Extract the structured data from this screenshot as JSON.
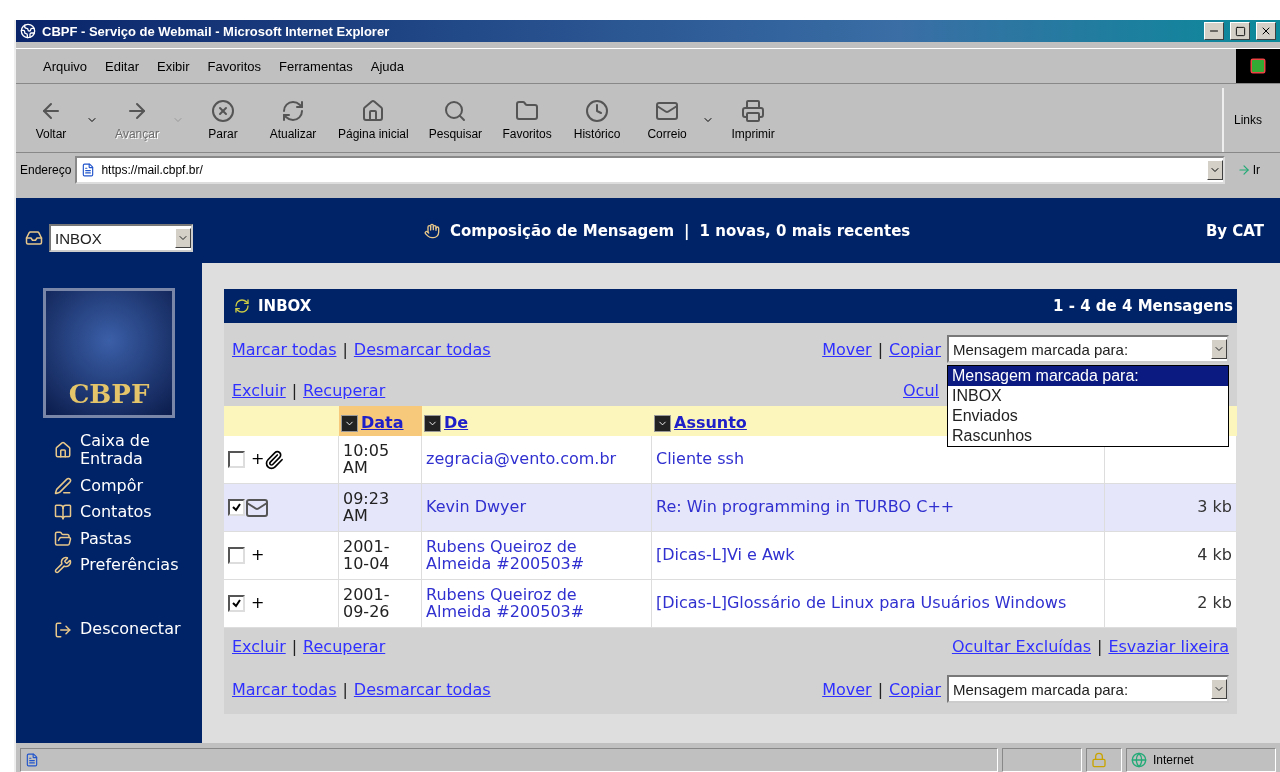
{
  "window": {
    "title": "CBPF - Serviço de Webmail - Microsoft Internet Explorer"
  },
  "menu": [
    "Arquivo",
    "Editar",
    "Exibir",
    "Favoritos",
    "Ferramentas",
    "Ajuda"
  ],
  "toolbar": [
    {
      "kind": "back",
      "label": "Voltar",
      "disabled": false,
      "dropdown": true
    },
    {
      "kind": "forward",
      "label": "Avançar",
      "disabled": true,
      "dropdown": true
    },
    {
      "kind": "stop",
      "label": "Parar",
      "disabled": false,
      "dropdown": false
    },
    {
      "kind": "refresh",
      "label": "Atualizar",
      "disabled": false,
      "dropdown": false
    },
    {
      "kind": "home",
      "label": "Página inicial",
      "disabled": false,
      "dropdown": false
    },
    {
      "kind": "search",
      "label": "Pesquisar",
      "disabled": false,
      "dropdown": false
    },
    {
      "kind": "favorites",
      "label": "Favoritos",
      "disabled": false,
      "dropdown": false
    },
    {
      "kind": "history",
      "label": "Histórico",
      "disabled": false,
      "dropdown": false
    },
    {
      "kind": "mail",
      "label": "Correio",
      "disabled": false,
      "dropdown": true
    },
    {
      "kind": "print",
      "label": "Imprimir",
      "disabled": false,
      "dropdown": false
    }
  ],
  "links_label": "Links",
  "address": {
    "label": "Endereço",
    "value": "https://mail.cbpf.br/",
    "go": "Ir"
  },
  "sidebar": {
    "folder": "INBOX",
    "logo_text": "CBPF",
    "items": [
      {
        "kind": "home",
        "label": "Caixa de Entrada"
      },
      {
        "kind": "compose",
        "label": "Compôr"
      },
      {
        "kind": "contacts",
        "label": "Contatos"
      },
      {
        "kind": "folders",
        "label": "Pastas"
      },
      {
        "kind": "prefs",
        "label": "Preferências"
      },
      {
        "kind": "logout",
        "label": "Desconectar"
      }
    ]
  },
  "header": {
    "compose": "Composição de Mensagem",
    "separator": "|",
    "status": "1 novas, 0 mais recentes",
    "credit": "By CAT"
  },
  "panel": {
    "title": "INBOX",
    "count": "1 - 4 de 4 Mensagens",
    "top_bar": {
      "mark_all": "Marcar todas",
      "unmark_all": "Desmarcar todas",
      "move": "Mover",
      "copy": "Copiar",
      "target": "Mensagem marcada para:"
    },
    "top_bar_2": {
      "delete": "Excluir",
      "undelete": "Recuperar",
      "hide_deleted": "Ocul"
    },
    "bottom_bar": {
      "delete": "Excluir",
      "undelete": "Recuperar",
      "hide_deleted": "Ocultar Excluídas",
      "empty_trash": "Esvaziar lixeira"
    },
    "bottom_bar_2": {
      "mark_all": "Marcar todas",
      "unmark_all": "Desmarcar todas",
      "move": "Mover",
      "copy": "Copiar",
      "target": "Mensagem marcada para:"
    },
    "separator": "|",
    "dropdown": [
      {
        "label": "Mensagem marcada para:",
        "selected": true
      },
      {
        "label": "INBOX",
        "selected": false
      },
      {
        "label": "Enviados",
        "selected": false
      },
      {
        "label": "Rascunhos",
        "selected": false
      }
    ]
  },
  "columns": [
    {
      "label": "Data",
      "sorted": true
    },
    {
      "label": "De",
      "sorted": false
    },
    {
      "label": "Assunto",
      "sorted": false
    }
  ],
  "rows": [
    {
      "checked": false,
      "flag": "+",
      "kind": "attachment",
      "highlighted": false,
      "date": "10:05 AM",
      "from": "zegracia@vento.com.br",
      "subject": "Cliente ssh"
    },
    {
      "checked": true,
      "kind": "new",
      "highlighted": true,
      "date": "09:23 AM",
      "from": "Kevin Dwyer",
      "subject": "Re: Win programming in TURBO C++",
      "size": "3 kb"
    },
    {
      "checked": false,
      "flag": "+",
      "kind": "plain",
      "highlighted": false,
      "date": "2001-10-04",
      "from": "Rubens Queiroz de Almeida #200503#",
      "subject": "[Dicas-L]Vi e Awk",
      "size": "4 kb"
    },
    {
      "checked": true,
      "flag": "+",
      "kind": "plain",
      "highlighted": false,
      "date": "2001-09-26",
      "from": "Rubens Queiroz de Almeida #200503#",
      "subject": "[Dicas-L]Glossário de Linux para Usuários Windows",
      "size": "2 kb"
    }
  ],
  "status_bar": {
    "zone": "Internet"
  }
}
